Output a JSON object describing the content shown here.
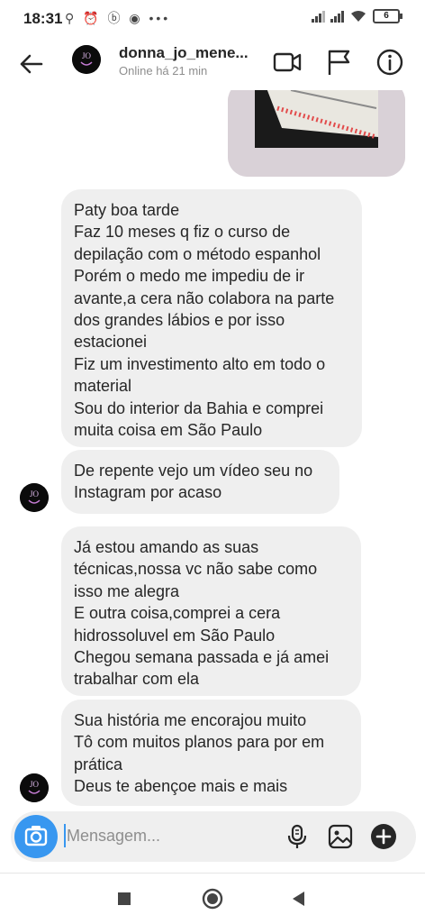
{
  "status_bar": {
    "time": "18:31",
    "left_icons": "⚲ ⏰  ⓑ ◉ •••",
    "battery": "6"
  },
  "header": {
    "username": "donna_jo_mene...",
    "status": "Online há 21 min",
    "icons": [
      "back-arrow-icon",
      "video-camera-icon",
      "flag-icon",
      "info-icon"
    ]
  },
  "messages": [
    "Paty boa tarde\nFaz 10 meses q fiz o curso de depilação com o método espanhol\nPorém o medo me impediu de ir avante,a cera não colabora na parte dos grandes lábios e por isso estacionei\nFiz um investimento alto em todo o material\nSou do interior da Bahia e comprei muita coisa em São Paulo",
    "De repente vejo um vídeo seu no Instagram por acaso",
    "Já estou amando as suas técnicas,nossa vc não sabe como isso me alegra\nE outra coisa,comprei a cera hidrossoluvel em São Paulo\nChegou semana passada e já amei trabalhar com ela",
    "Sua história me encorajou muito\nTô com muitos planos para por em prática\nDeus te abençoe mais e mais"
  ],
  "composer": {
    "placeholder": "Mensagem...",
    "icons": [
      "camera-icon",
      "microphone-icon",
      "gallery-icon",
      "plus-icon"
    ]
  },
  "colors": {
    "accent": "#3897f0",
    "bubble": "#efefef",
    "text": "#262626",
    "muted": "#8e8e8e"
  }
}
